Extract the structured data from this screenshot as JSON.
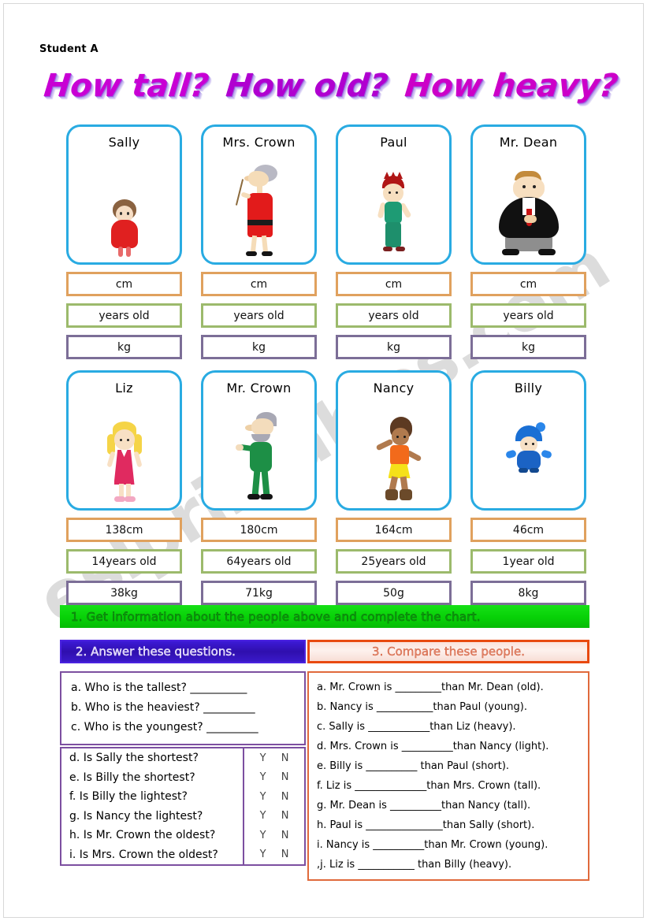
{
  "header": {
    "student_tag": "Student A",
    "title_parts": [
      "How tall?",
      "How old?",
      "How heavy?"
    ]
  },
  "watermark": {
    "text": "eslprintables.com"
  },
  "colors": {
    "card_border": "#29abe2",
    "height_border": "#e0a15e",
    "age_border": "#9cba6c",
    "weight_border": "#7c6e97",
    "bar_green": "#07d107",
    "bar_blue": "#2f0fae",
    "bar_red": "#e84a10",
    "panel_purple": "#7c4fa0",
    "panel_orange": "#e06a3c",
    "title_magenta": "#c800d4"
  },
  "units": {
    "height": "cm",
    "age": "years old",
    "weight": "kg"
  },
  "people": [
    {
      "name": "Sally",
      "figure": "sally",
      "height": "cm",
      "age": "years old",
      "weight": "kg"
    },
    {
      "name": "Mrs. Crown",
      "figure": "mrscrown",
      "height": "cm",
      "age": "years old",
      "weight": "kg"
    },
    {
      "name": "Paul",
      "figure": "paul",
      "height": "cm",
      "age": "years old",
      "weight": "kg"
    },
    {
      "name": "Mr. Dean",
      "figure": "dean",
      "height": "cm",
      "age": "years old",
      "weight": "kg"
    },
    {
      "name": "Liz",
      "figure": "liz",
      "height": "138cm",
      "age": "14years old",
      "weight": "38kg"
    },
    {
      "name": "Mr. Crown",
      "figure": "mrcrown",
      "height": "180cm",
      "age": "64years old",
      "weight": "71kg"
    },
    {
      "name": "Nancy",
      "figure": "nancy",
      "height": "164cm",
      "age": "25years old",
      "weight": "50g"
    },
    {
      "name": "Billy",
      "figure": "billy",
      "height": "46cm",
      "age": "1year old",
      "weight": "8kg"
    }
  ],
  "sections": {
    "one": {
      "label": "1. Get information about the people above and complete the chart."
    },
    "two": {
      "label": "2. Answer these questions."
    },
    "three": {
      "label": "3. Compare these people."
    }
  },
  "open_questions": [
    {
      "text": "a. Who is the tallest?",
      "blank": "___________"
    },
    {
      "text": "b. Who is the heaviest?",
      "blank": "__________"
    },
    {
      "text": "c. Who is the youngest?",
      "blank": "__________"
    }
  ],
  "yn_questions": [
    {
      "text": "d. Is Sally the shortest?",
      "yes": "Y",
      "no": "N"
    },
    {
      "text": "e. Is Billy the shortest?",
      "yes": "Y",
      "no": "N"
    },
    {
      "text": "f. Is Billy the lightest?",
      "yes": "Y",
      "no": "N"
    },
    {
      "text": "g. Is Nancy the lightest?",
      "yes": "Y",
      "no": "N"
    },
    {
      "text": "h. Is Mr. Crown the oldest?",
      "yes": "Y",
      "no": "N"
    },
    {
      "text": "i. Is Mrs. Crown the oldest?",
      "yes": "Y",
      "no": "N"
    }
  ],
  "compare_items": [
    {
      "text": "a. Mr. Crown is _________than Mr. Dean (old)."
    },
    {
      "text": "b. Nancy is ___________than Paul (young)."
    },
    {
      "text": "c. Sally is ____________than Liz (heavy)."
    },
    {
      "text": "d. Mrs. Crown is __________than Nancy (light)."
    },
    {
      "text": "e. Billy is __________ than Paul (short)."
    },
    {
      "text": "f. Liz is ______________than Mrs. Crown (tall)."
    },
    {
      "text": "g. Mr. Dean is __________than Nancy (tall)."
    },
    {
      "text": "h. Paul is _______________than Sally (short)."
    },
    {
      "text": "i. Nancy is __________than Mr. Crown (young)."
    },
    {
      "text": ",j. Liz is ___________ than Billy (heavy)."
    }
  ]
}
